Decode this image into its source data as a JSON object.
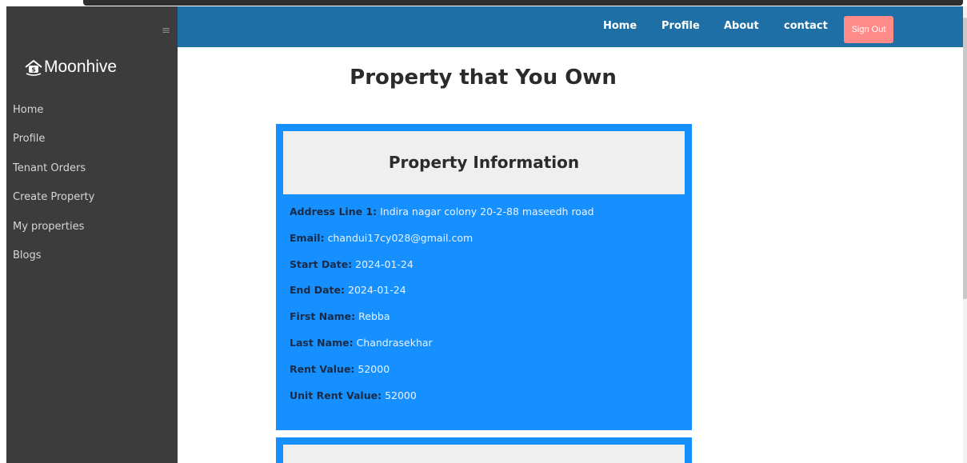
{
  "brand": {
    "name": "Moonhive",
    "logo_icon": "house-money-icon"
  },
  "sidebar": {
    "items": [
      {
        "label": "Home"
      },
      {
        "label": "Profile"
      },
      {
        "label": "Tenant Orders"
      },
      {
        "label": "Create Property"
      },
      {
        "label": "My properties"
      },
      {
        "label": "Blogs"
      }
    ]
  },
  "topnav": {
    "links": [
      {
        "label": "Home"
      },
      {
        "label": "Profile"
      },
      {
        "label": "About"
      },
      {
        "label": "contact"
      }
    ],
    "signout_label": "Sign Out"
  },
  "main": {
    "title": "Property that You Own",
    "card": {
      "header": "Property Information",
      "fields": [
        {
          "label": "Address Line 1:",
          "value": "Indira nagar colony 20-2-88 maseedh road"
        },
        {
          "label": "Email:",
          "value": "chandui17cy028@gmail.com"
        },
        {
          "label": "Start Date:",
          "value": "2024-01-24"
        },
        {
          "label": "End Date:",
          "value": "2024-01-24"
        },
        {
          "label": "First Name:",
          "value": "Rebba"
        },
        {
          "label": "Last Name:",
          "value": "Chandrasekhar"
        },
        {
          "label": "Rent Value:",
          "value": "52000"
        },
        {
          "label": "Unit Rent Value:",
          "value": "52000"
        }
      ]
    }
  },
  "colors": {
    "sidebar_bg": "#3c3c3c",
    "topnav_bg": "#1e6fa6",
    "card_bg": "#1790ff",
    "signout_bg": "#ff8a8a"
  }
}
